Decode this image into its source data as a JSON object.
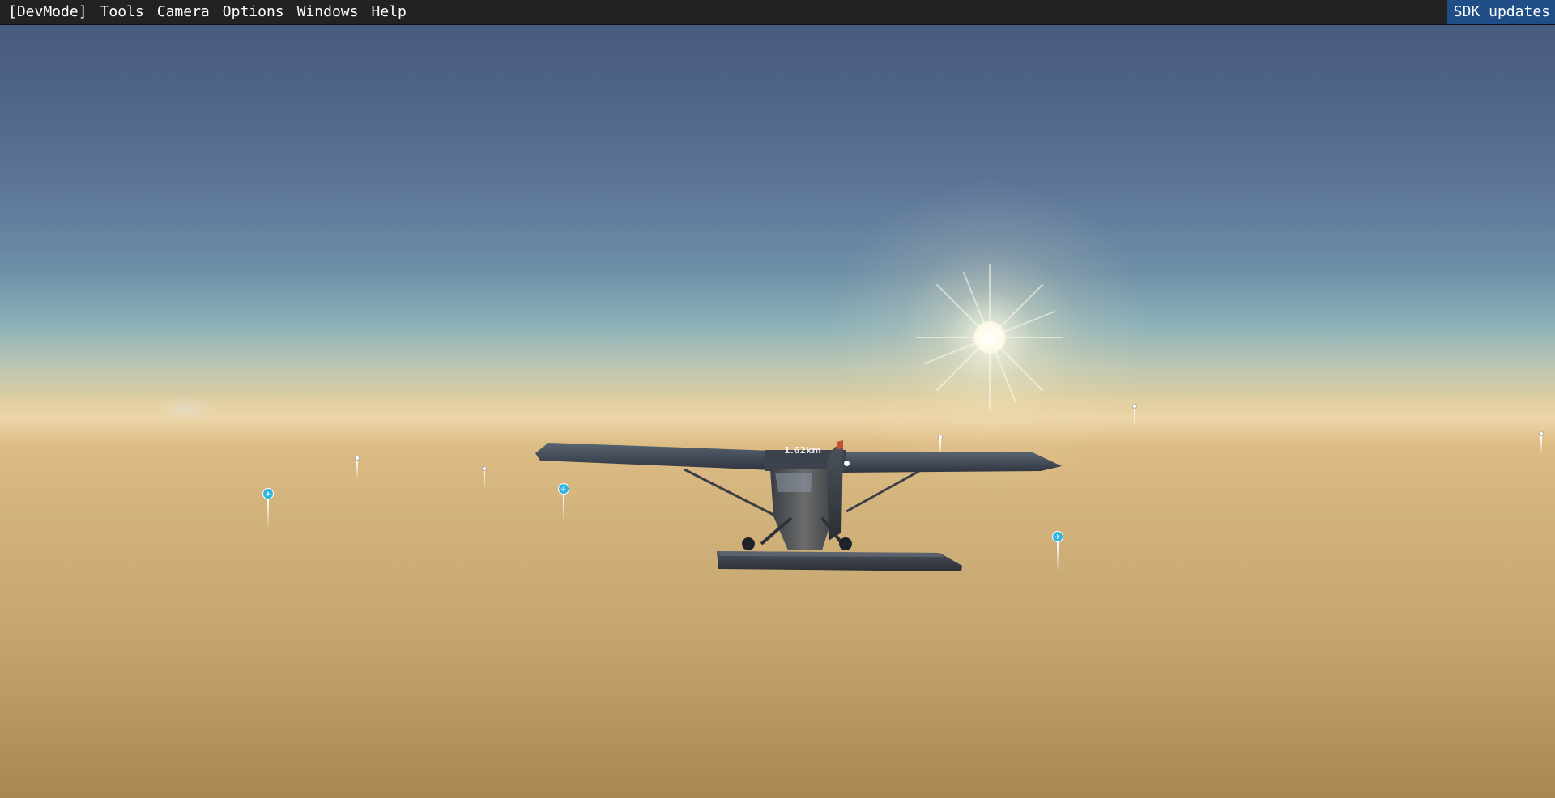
{
  "menubar": {
    "items": [
      {
        "label": "[DevMode]"
      },
      {
        "label": "Tools"
      },
      {
        "label": "Camera"
      },
      {
        "label": "Options"
      },
      {
        "label": "Windows"
      },
      {
        "label": "Help"
      }
    ],
    "sdk_updates_label": "SDK updates"
  },
  "scene": {
    "aircraft_distance_label": "1.62km",
    "poi_icon": "airport-pin-icon",
    "waypoint_icon": "waypoint-dot-icon"
  },
  "colors": {
    "menubar_bg": "#222222",
    "sdk_button_bg": "#1f4e86",
    "poi_pin": "#2fb3e0"
  }
}
